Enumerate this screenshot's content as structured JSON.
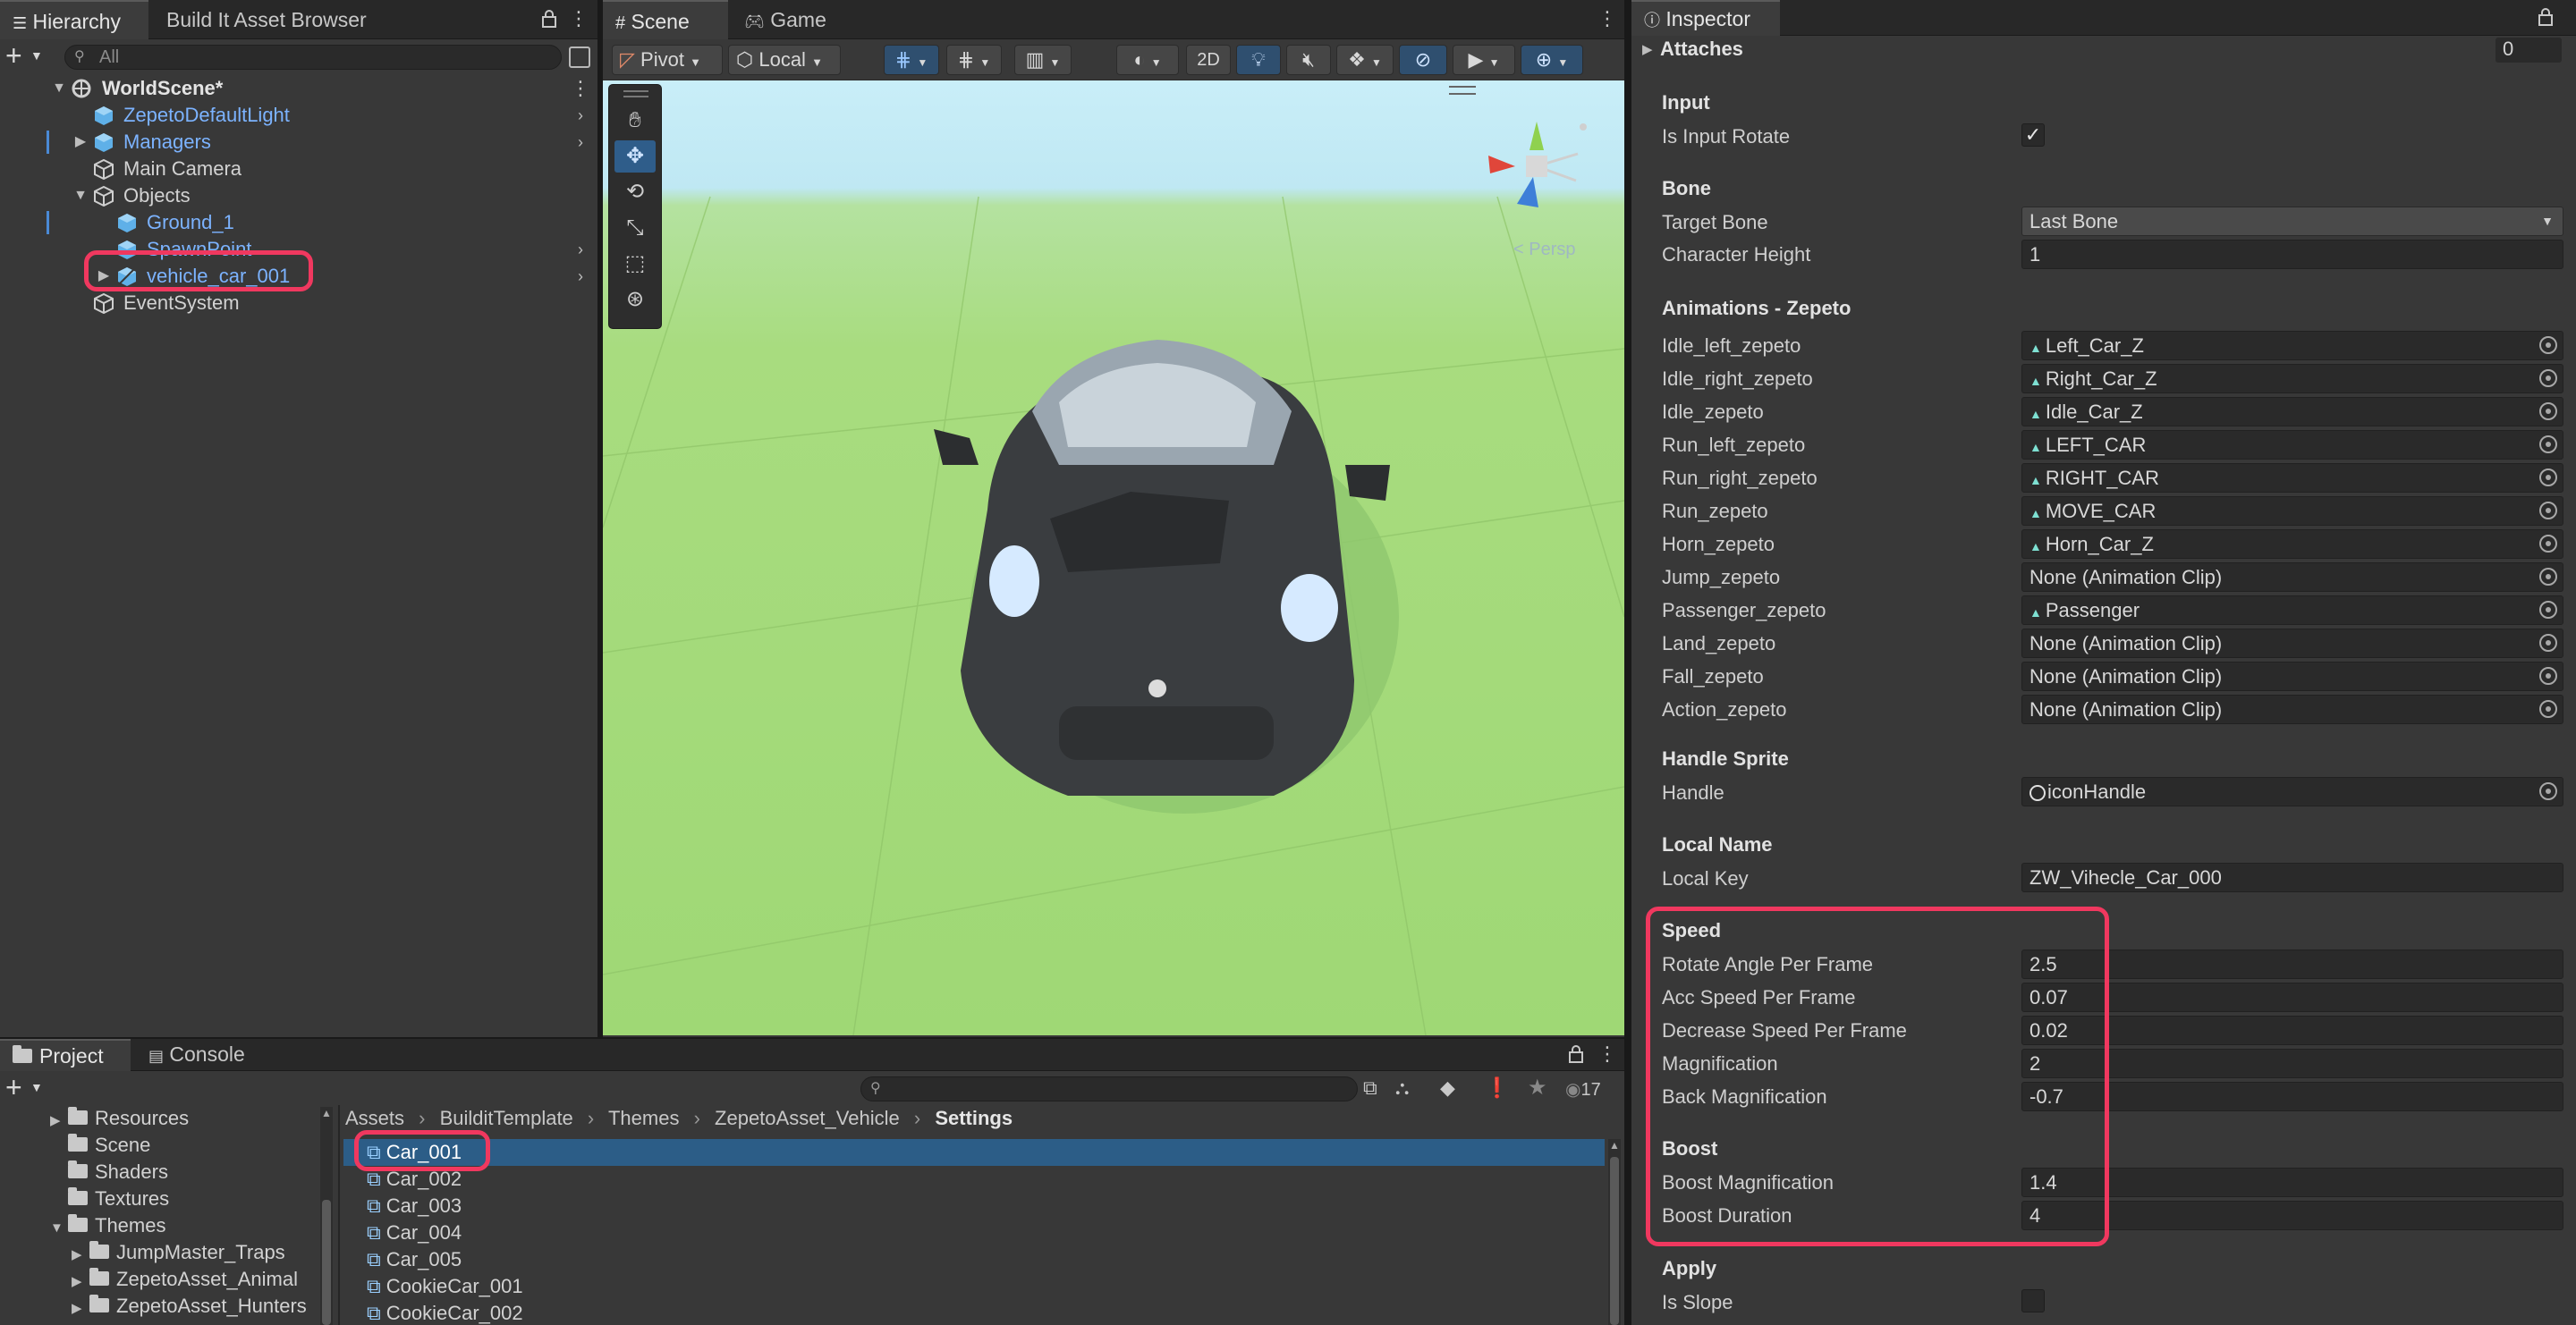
{
  "hierarchy": {
    "tabs": [
      "Hierarchy",
      "Build It Asset Browser"
    ],
    "search_placeholder": "All",
    "scene_name": "WorldScene*",
    "items": [
      {
        "label": "ZepetoDefaultLight",
        "blue": true
      },
      {
        "label": "Managers",
        "blue": true
      },
      {
        "label": "Main Camera",
        "blue": false
      },
      {
        "label": "Objects",
        "blue": false
      },
      {
        "label": "Ground_1",
        "blue": true
      },
      {
        "label": "SpawnPoint",
        "blue": true
      },
      {
        "label": "vehicle_car_001",
        "blue": true
      },
      {
        "label": "EventSystem",
        "blue": false
      }
    ]
  },
  "scene": {
    "tabs": [
      "Scene",
      "Game"
    ],
    "pivot": "Pivot",
    "local": "Local",
    "mode_2d": "2D",
    "persp_label": "< Persp"
  },
  "inspector": {
    "tab": "Inspector",
    "attaches_label": "Attaches",
    "attaches_value": "0",
    "sections": {
      "input": "Input",
      "bone": "Bone",
      "animations": "Animations - Zepeto",
      "handle_sprite": "Handle Sprite",
      "local_name": "Local Name",
      "speed": "Speed",
      "boost": "Boost",
      "apply": "Apply"
    },
    "is_input_rotate": {
      "label": "Is Input Rotate",
      "checked": true
    },
    "target_bone": {
      "label": "Target Bone",
      "value": "Last Bone"
    },
    "character_height": {
      "label": "Character Height",
      "value": "1"
    },
    "animations": [
      {
        "label": "Idle_left_zepeto",
        "value": "Left_Car_Z",
        "clip": true
      },
      {
        "label": "Idle_right_zepeto",
        "value": "Right_Car_Z",
        "clip": true
      },
      {
        "label": "Idle_zepeto",
        "value": "Idle_Car_Z",
        "clip": true
      },
      {
        "label": "Run_left_zepeto",
        "value": "LEFT_CAR",
        "clip": true
      },
      {
        "label": "Run_right_zepeto",
        "value": "RIGHT_CAR",
        "clip": true
      },
      {
        "label": "Run_zepeto",
        "value": "MOVE_CAR",
        "clip": true
      },
      {
        "label": "Horn_zepeto",
        "value": "Horn_Car_Z",
        "clip": true
      },
      {
        "label": "Jump_zepeto",
        "value": "None (Animation Clip)",
        "clip": false
      },
      {
        "label": "Passenger_zepeto",
        "value": "Passenger",
        "clip": true
      },
      {
        "label": "Land_zepeto",
        "value": "None (Animation Clip)",
        "clip": false
      },
      {
        "label": "Fall_zepeto",
        "value": "None (Animation Clip)",
        "clip": false
      },
      {
        "label": "Action_zepeto",
        "value": "None (Animation Clip)",
        "clip": false
      }
    ],
    "handle": {
      "label": "Handle",
      "value": "iconHandle"
    },
    "local_key": {
      "label": "Local Key",
      "value": "ZW_Vihecle_Car_000"
    },
    "speed_fields": [
      {
        "label": "Rotate Angle Per Frame",
        "value": "2.5"
      },
      {
        "label": "Acc Speed Per Frame",
        "value": "0.07"
      },
      {
        "label": "Decrease Speed Per Frame",
        "value": "0.02"
      },
      {
        "label": "Magnification",
        "value": "2"
      },
      {
        "label": "Back Magnification",
        "value": "-0.7"
      }
    ],
    "boost_fields": [
      {
        "label": "Boost Magnification",
        "value": "1.4"
      },
      {
        "label": "Boost Duration",
        "value": "4"
      }
    ],
    "is_slope": {
      "label": "Is Slope",
      "checked": false
    }
  },
  "project": {
    "tabs": [
      "Project",
      "Console"
    ],
    "badge_count": "17",
    "breadcrumb": [
      "Assets",
      "BuilditTemplate",
      "Themes",
      "ZepetoAsset_Vehicle",
      "Settings"
    ],
    "tree": [
      {
        "label": "Resources",
        "indent": 1,
        "caret": "▶"
      },
      {
        "label": "Scene",
        "indent": 1,
        "caret": ""
      },
      {
        "label": "Shaders",
        "indent": 1,
        "caret": ""
      },
      {
        "label": "Textures",
        "indent": 1,
        "caret": ""
      },
      {
        "label": "Themes",
        "indent": 0,
        "caret": "▼"
      },
      {
        "label": "JumpMaster_Traps",
        "indent": 1,
        "caret": "▶"
      },
      {
        "label": "ZepetoAsset_Animal",
        "indent": 1,
        "caret": "▶"
      },
      {
        "label": "ZepetoAsset_Hunters",
        "indent": 1,
        "caret": "▶"
      }
    ],
    "files": [
      "Car_001",
      "Car_002",
      "Car_003",
      "Car_004",
      "Car_005",
      "CookieCar_001",
      "CookieCar_002"
    ]
  },
  "colors": {
    "highlight": "#f0385f",
    "selection": "#2c5d87",
    "sky": "#c5ecf6",
    "ground": "#a6dd7d"
  }
}
